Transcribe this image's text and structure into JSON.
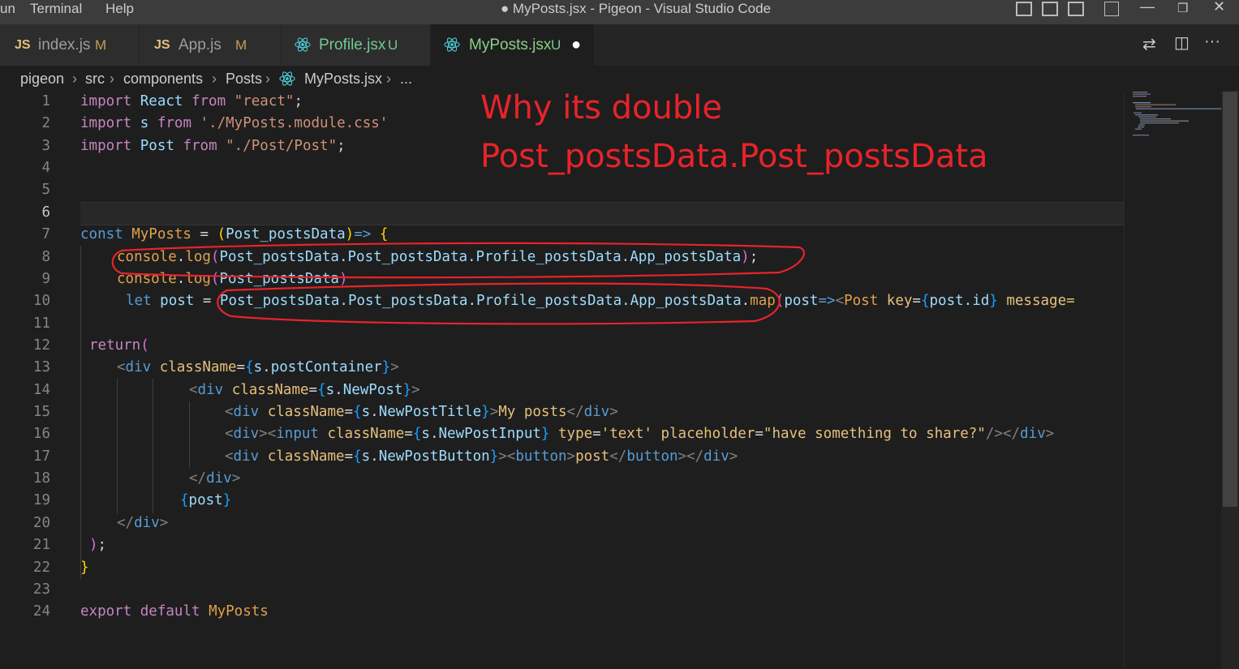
{
  "window": {
    "menu": [
      "un",
      "Terminal",
      "Help"
    ],
    "title": "● MyPosts.jsx - Pigeon - Visual Studio Code"
  },
  "tabs": [
    {
      "icon": "JS",
      "label": "index.js",
      "status": "M"
    },
    {
      "icon": "JS",
      "label": "App.js",
      "status": "M"
    },
    {
      "icon": "react-icon",
      "label": "Profile.jsx",
      "status": "U"
    },
    {
      "icon": "react-icon",
      "label": "MyPosts.jsx",
      "status": "U",
      "dirty": "●",
      "active": true
    }
  ],
  "breadcrumb": [
    "pigeon",
    "src",
    "components",
    "Posts",
    "MyPosts.jsx",
    "..."
  ],
  "line_numbers": [
    "1",
    "2",
    "3",
    "4",
    "5",
    "6",
    "7",
    "8",
    "9",
    "10",
    "11",
    "12",
    "13",
    "14",
    "15",
    "16",
    "17",
    "18",
    "19",
    "20",
    "21",
    "22",
    "23",
    "24"
  ],
  "code": {
    "l1": {
      "a": "import ",
      "b": "React",
      "c": " from ",
      "d": "\"react\"",
      "e": ";"
    },
    "l2": {
      "a": "import ",
      "b": "s",
      "c": " from ",
      "d": "'./MyPosts.module.css'"
    },
    "l3": {
      "a": "import ",
      "b": "Post",
      "c": " from ",
      "d": "\"./Post/Post\"",
      "e": ";"
    },
    "l7": {
      "a": "const ",
      "b": "MyPosts",
      "c": " = ",
      "d": "(",
      "e": "Post_postsData",
      "f": ")",
      "g": "=>",
      "h": " {"
    },
    "l8": {
      "a": "console",
      "b": ".",
      "c": "log",
      "d": "(",
      "e": "Post_postsData.Post_postsData.Profile_postsData.App_postsData",
      "f": ")",
      "g": ";"
    },
    "l9": {
      "a": "console",
      "b": ".",
      "c": "log",
      "d": "(",
      "e": "Post_postsData",
      "f": ")"
    },
    "l10": {
      "a": "let ",
      "b": "post",
      "c": " = ",
      "d": "Post_postsData.Post_postsData.Profile_postsData.App_postsData",
      "e": ".",
      "f": "map",
      "g": "(",
      "h": "post",
      "i": "=>",
      "j": "<",
      "k": "Post",
      "l": " key",
      "m": "=",
      "n": "{",
      "o": "post.id",
      "p": "}",
      "q": " message="
    },
    "l12": {
      "a": "return",
      "b": "("
    },
    "l13": {
      "a": "<",
      "b": "div",
      "c": " className",
      "d": "=",
      "e": "{",
      "f": "s",
      "g": ".",
      "h": "postContainer",
      "i": "}",
      "j": ">"
    },
    "l14": {
      "a": "<",
      "b": "div",
      "c": " className",
      "d": "=",
      "e": "{",
      "f": "s",
      "g": ".",
      "h": "NewPost",
      "i": "}",
      "j": ">"
    },
    "l15": {
      "a": "<",
      "b": "div",
      "c": " className",
      "d": "=",
      "e": "{",
      "f": "s",
      "g": ".",
      "h": "NewPostTitle",
      "i": "}",
      "j": ">",
      "k": "My posts",
      "l": "</",
      "m": "div",
      "n": ">"
    },
    "l16": {
      "a": "<",
      "b": "div",
      "c": ">",
      "d": "<",
      "e": "input",
      "f": " className",
      "g": "=",
      "h": "{",
      "i": "s",
      "j": ".",
      "k": "NewPostInput",
      "l": "}",
      "m": " type",
      "n": "=",
      "o": "'text'",
      "p": " placeholder",
      "q": "=",
      "r": "\"have something to share?\"",
      "s": "/>",
      "t": "</",
      "u": "div",
      "v": ">"
    },
    "l17": {
      "a": "<",
      "b": "div",
      "c": " className",
      "d": "=",
      "e": "{",
      "f": "s",
      "g": ".",
      "h": "NewPostButton",
      "i": "}",
      "j": ">",
      "k": "<",
      "l": "button",
      "m": ">",
      "n": "post",
      "o": "</",
      "p": "button",
      "q": ">",
      "r": "</",
      "s": "div",
      "t": ">"
    },
    "l18": {
      "a": "</",
      "b": "div",
      "c": ">"
    },
    "l19": {
      "a": "{",
      "b": "post",
      "c": "}"
    },
    "l20": {
      "a": "</",
      "b": "div",
      "c": ">"
    },
    "l21": {
      "a": ")",
      "b": ";"
    },
    "l22": {
      "a": "}"
    },
    "l24": {
      "a": "export ",
      "b": "default ",
      "c": "MyPosts"
    }
  },
  "annotation": {
    "line1": "Why its double",
    "line2": "Post_postsData.Post_postsData"
  }
}
